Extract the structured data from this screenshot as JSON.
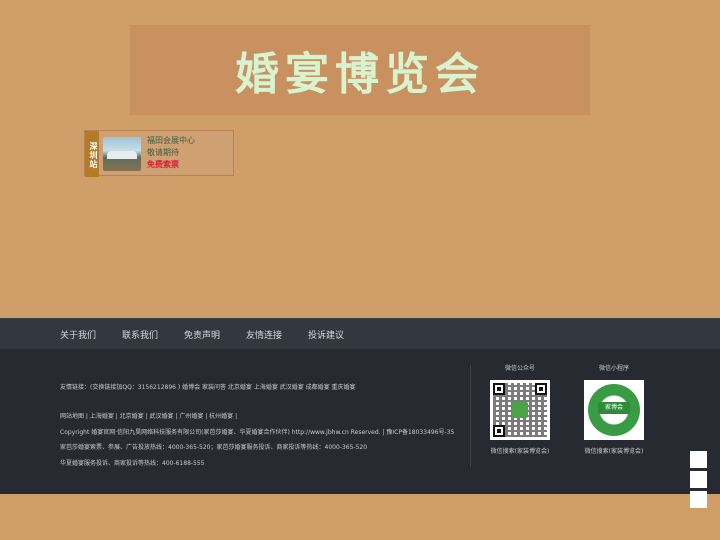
{
  "banner": {
    "title": "婚宴博览会"
  },
  "venue": {
    "city": "深圳站",
    "name": "福田会展中心",
    "status": "敬请期待",
    "ticket": "免费索票"
  },
  "footer_nav": {
    "items": [
      "关于我们",
      "联系我们",
      "免责声明",
      "友情连接",
      "投诉建议"
    ]
  },
  "footer": {
    "links_line": "友情链接：(交换链接加QQ：3156212896 ) 婚博会   家装问答   北京婚宴   上海婚宴   武汉婚宴   成都婚宴   重庆婚宴",
    "sitemap_line": "网站地图 | 上海婚宴 | 北京婚宴 | 武汉婚宴 | 广州婚宴 | 杭州婚宴 |",
    "copyright_line": "Copyright 婚宴官网·信阳九昊网络科技服务有限公司(家芭莎婚宴、华夏婚宴合作伙伴) http://www.jbhw.cn Reserved. | 豫ICP备18033496号-35",
    "hotline1_line": "家芭莎婚宴索票、参展、广告投放热线：4000-365-520；家芭莎婚宴服务投诉、商家投诉等热线：4000-365-520",
    "hotline2_line": "华夏婚宴服务投诉、商家投诉等热线：400-6188-555",
    "qr_official": {
      "label": "微信公众号",
      "caption": "微信搜索(家装博览会)"
    },
    "qr_mini": {
      "label": "微信小程序",
      "caption": "微信搜索(家装博览会)",
      "badge": "家博会"
    }
  },
  "colors": {
    "background": "#d09e69",
    "banner_text": "#d7f3cf",
    "ticket": "#d8203a",
    "footer": "#272a31"
  }
}
